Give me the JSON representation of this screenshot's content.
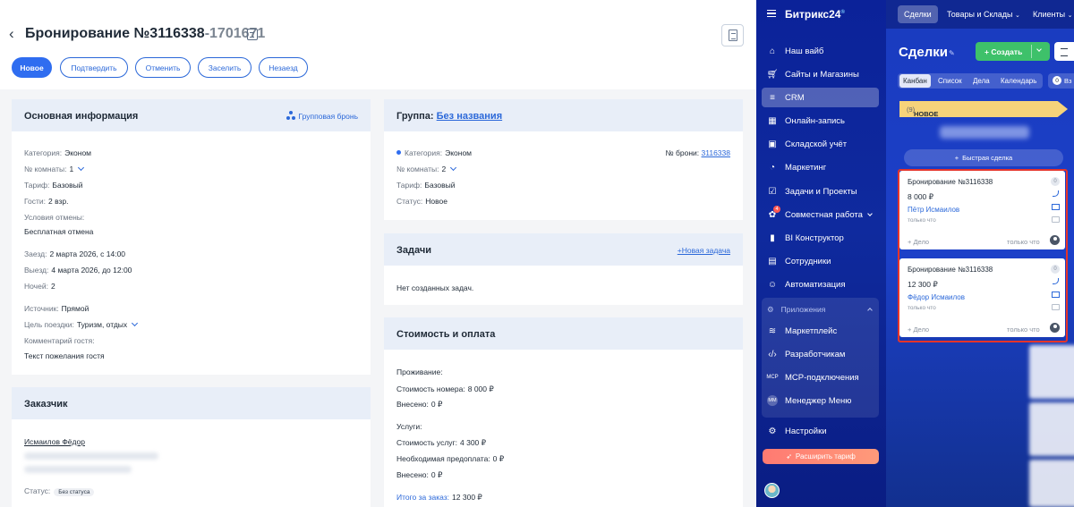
{
  "booking": {
    "title": "Бронирование №3116338",
    "title_suffix": "-1701671",
    "actions": [
      "Новое",
      "Подтвердить",
      "Отменить",
      "Заселить",
      "Незаезд"
    ],
    "main_info": {
      "header": "Основная информация",
      "group_link": "Групповая бронь",
      "category_label": "Категория:",
      "category_value": "Эконом",
      "room_label": "№ комнаты:",
      "room_value": "1",
      "tariff_label": "Тариф:",
      "tariff_value": "Базовый",
      "guests_label": "Гости:",
      "guests_value": "2 взр.",
      "cancel_label": "Условия отмены:",
      "cancel_value": "Бесплатная отмена",
      "checkin_label": "Заезд:",
      "checkin_value": "2 марта 2026, с 14:00",
      "checkout_label": "Выезд:",
      "checkout_value": "4 марта 2026, до 12:00",
      "nights_label": "Ночей:",
      "nights_value": "2",
      "source_label": "Источник:",
      "source_value": "Прямой",
      "purpose_label": "Цель поездки:",
      "purpose_value": "Туризм, отдых",
      "comment_label": "Комментарий гостя:",
      "comment_value": "Текст пожелания гостя"
    },
    "customer": {
      "header": "Заказчик",
      "name": "Исмаилов Фёдор",
      "status_label": "Статус:",
      "status_value": "Без статуса"
    },
    "group": {
      "header_label": "Группа:",
      "header_link": "Без названия",
      "category_label": "Категория:",
      "category_value": "Эконом",
      "booking_no_label": "№ брони:",
      "booking_no_value": "3116338",
      "room_label": "№ комнаты:",
      "room_value": "2",
      "tariff_label": "Тариф:",
      "tariff_value": "Базовый",
      "status_label": "Статус:",
      "status_value": "Новое"
    },
    "tasks": {
      "header": "Задачи",
      "new_link": "+Новая задача",
      "empty": "Нет созданных задач."
    },
    "cost": {
      "header": "Стоимость и оплата",
      "stay_label": "Проживание:",
      "room_cost_label": "Стоимость номера:",
      "room_cost_value": "8 000 ₽",
      "paid1_label": "Внесено:",
      "paid1_value": "0 ₽",
      "services_label": "Услуги:",
      "services_cost_label": "Стоимость услуг:",
      "services_cost_value": "4 300 ₽",
      "prepay_label": "Необходимая предоплата:",
      "prepay_value": "0 ₽",
      "paid2_label": "Внесено:",
      "paid2_value": "0 ₽",
      "total_label": "Итого за заказ:",
      "total_value": "12 300 ₽"
    }
  },
  "bitrix": {
    "brand": "Битрикс24",
    "brand_mark": "®",
    "menu": [
      {
        "label": "Наш вайб",
        "icon": "home-icon"
      },
      {
        "label": "Сайты и Магазины",
        "icon": "cart-icon"
      },
      {
        "label": "CRM",
        "icon": "filter-icon"
      },
      {
        "label": "Онлайн-запись",
        "icon": "calendar-icon"
      },
      {
        "label": "Складской учёт",
        "icon": "warehouse-icon"
      },
      {
        "label": "Маркетинг",
        "icon": "marketing-icon"
      },
      {
        "label": "Задачи и Проекты",
        "icon": "checkbox-icon"
      },
      {
        "label": "Совместная работа",
        "icon": "collab-icon",
        "badge": "4"
      },
      {
        "label": "BI Конструктор",
        "icon": "bar-chart-icon"
      },
      {
        "label": "Сотрудники",
        "icon": "id-card-icon"
      },
      {
        "label": "Автоматизация",
        "icon": "robot-icon"
      }
    ],
    "apps_header": "Приложения",
    "apps": [
      {
        "label": "Маркетплейс",
        "icon": "marketplace-icon"
      },
      {
        "label": "Разработчикам",
        "icon": "code-icon"
      },
      {
        "label": "MCP-подключения",
        "icon": "mcp-icon",
        "glyph": "MCP"
      },
      {
        "label": "Менеджер Меню",
        "icon": "mm-icon",
        "glyph": "MM"
      }
    ],
    "settings": "Настройки",
    "expand_tariff": "Расширить тариф",
    "top_tabs": [
      "Сделки",
      "Товары и Склады",
      "Клиенты"
    ],
    "crm_title": "Сделки",
    "create_button": "Создать",
    "view_tabs": [
      "Канбан",
      "Список",
      "Дела",
      "Календарь"
    ],
    "counter": "0",
    "counter_text": "Вз",
    "stage_name": "НОВОЕ ОБРАЩЕНИЕ",
    "stage_count": "(9)",
    "quick_deal": "Быстрая сделка",
    "deals": [
      {
        "name": "Бронирование №3116338",
        "sum": "8 000 ₽",
        "client": "Пётр Исмаилов",
        "ago": "только что",
        "add_task": "+ Дело",
        "time": "только что",
        "count": "0"
      },
      {
        "name": "Бронирование №3116338",
        "sum": "12 300 ₽",
        "client": "Фёдор Исмаилов",
        "ago": "только что",
        "add_task": "+ Дело",
        "time": "только что",
        "count": "0"
      }
    ]
  }
}
